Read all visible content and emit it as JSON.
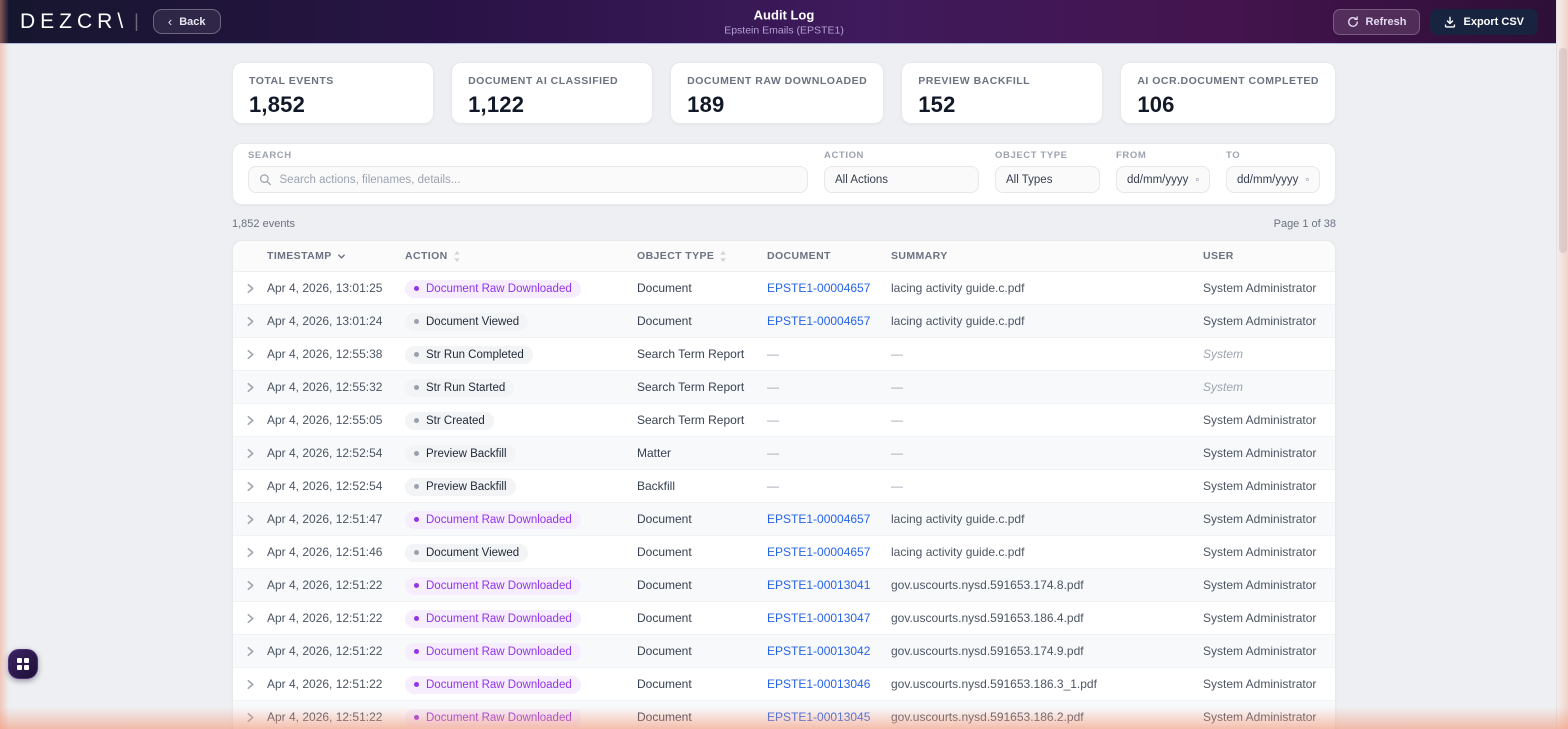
{
  "header": {
    "brand": "DEZCR\\",
    "back_label": "Back",
    "title": "Audit Log",
    "subtitle": "Epstein Emails (EPSTE1)",
    "refresh_label": "Refresh",
    "export_label": "Export CSV"
  },
  "stats": [
    {
      "label": "TOTAL EVENTS",
      "value": "1,852"
    },
    {
      "label": "DOCUMENT AI CLASSIFIED",
      "value": "1,122"
    },
    {
      "label": "DOCUMENT RAW DOWNLOADED",
      "value": "189"
    },
    {
      "label": "PREVIEW BACKFILL",
      "value": "152"
    },
    {
      "label": "AI OCR.DOCUMENT COMPLETED",
      "value": "106"
    }
  ],
  "filters": {
    "search_label": "SEARCH",
    "search_placeholder": "Search actions, filenames, details...",
    "action_label": "ACTION",
    "action_value": "All Actions",
    "object_type_label": "OBJECT TYPE",
    "object_type_value": "All Types",
    "from_label": "FROM",
    "from_value": "dd/mm/yyyy",
    "to_label": "TO",
    "to_value": "dd/mm/yyyy"
  },
  "meta": {
    "events_count": "1,852 events",
    "page_info": "Page 1 of 38"
  },
  "table": {
    "columns": [
      {
        "label": "TIMESTAMP",
        "sort": "down"
      },
      {
        "label": "ACTION",
        "sort": "both"
      },
      {
        "label": "OBJECT TYPE",
        "sort": "both"
      },
      {
        "label": "DOCUMENT",
        "sort": "none"
      },
      {
        "label": "SUMMARY",
        "sort": "none"
      },
      {
        "label": "USER",
        "sort": "none"
      }
    ],
    "rows": [
      {
        "ts": "Apr 4, 2026, 13:01:25",
        "action": "Document Raw Downloaded",
        "style": "purple",
        "type": "Document",
        "doc": "EPSTE1-00004657",
        "summary": "lacing activity guide.c.pdf",
        "user": "System Administrator",
        "user_style": "normal"
      },
      {
        "ts": "Apr 4, 2026, 13:01:24",
        "action": "Document Viewed",
        "style": "gray",
        "type": "Document",
        "doc": "EPSTE1-00004657",
        "summary": "lacing activity guide.c.pdf",
        "user": "System Administrator",
        "user_style": "normal"
      },
      {
        "ts": "Apr 4, 2026, 12:55:38",
        "action": "Str Run Completed",
        "style": "gray",
        "type": "Search Term Report",
        "doc": "—",
        "summary": "—",
        "user": "System",
        "user_style": "italic"
      },
      {
        "ts": "Apr 4, 2026, 12:55:32",
        "action": "Str Run Started",
        "style": "gray",
        "type": "Search Term Report",
        "doc": "—",
        "summary": "—",
        "user": "System",
        "user_style": "italic"
      },
      {
        "ts": "Apr 4, 2026, 12:55:05",
        "action": "Str Created",
        "style": "gray",
        "type": "Search Term Report",
        "doc": "—",
        "summary": "—",
        "user": "System Administrator",
        "user_style": "normal"
      },
      {
        "ts": "Apr 4, 2026, 12:52:54",
        "action": "Preview Backfill",
        "style": "gray",
        "type": "Matter",
        "doc": "—",
        "summary": "—",
        "user": "System Administrator",
        "user_style": "normal"
      },
      {
        "ts": "Apr 4, 2026, 12:52:54",
        "action": "Preview Backfill",
        "style": "gray",
        "type": "Backfill",
        "doc": "—",
        "summary": "—",
        "user": "System Administrator",
        "user_style": "normal"
      },
      {
        "ts": "Apr 4, 2026, 12:51:47",
        "action": "Document Raw Downloaded",
        "style": "purple",
        "type": "Document",
        "doc": "EPSTE1-00004657",
        "summary": "lacing activity guide.c.pdf",
        "user": "System Administrator",
        "user_style": "normal"
      },
      {
        "ts": "Apr 4, 2026, 12:51:46",
        "action": "Document Viewed",
        "style": "gray",
        "type": "Document",
        "doc": "EPSTE1-00004657",
        "summary": "lacing activity guide.c.pdf",
        "user": "System Administrator",
        "user_style": "normal"
      },
      {
        "ts": "Apr 4, 2026, 12:51:22",
        "action": "Document Raw Downloaded",
        "style": "purple",
        "type": "Document",
        "doc": "EPSTE1-00013041",
        "summary": "gov.uscourts.nysd.591653.174.8.pdf",
        "user": "System Administrator",
        "user_style": "normal"
      },
      {
        "ts": "Apr 4, 2026, 12:51:22",
        "action": "Document Raw Downloaded",
        "style": "purple",
        "type": "Document",
        "doc": "EPSTE1-00013047",
        "summary": "gov.uscourts.nysd.591653.186.4.pdf",
        "user": "System Administrator",
        "user_style": "normal"
      },
      {
        "ts": "Apr 4, 2026, 12:51:22",
        "action": "Document Raw Downloaded",
        "style": "purple",
        "type": "Document",
        "doc": "EPSTE1-00013042",
        "summary": "gov.uscourts.nysd.591653.174.9.pdf",
        "user": "System Administrator",
        "user_style": "normal"
      },
      {
        "ts": "Apr 4, 2026, 12:51:22",
        "action": "Document Raw Downloaded",
        "style": "purple",
        "type": "Document",
        "doc": "EPSTE1-00013046",
        "summary": "gov.uscourts.nysd.591653.186.3_1.pdf",
        "user": "System Administrator",
        "user_style": "normal"
      },
      {
        "ts": "Apr 4, 2026, 12:51:22",
        "action": "Document Raw Downloaded",
        "style": "purple",
        "type": "Document",
        "doc": "EPSTE1-00013045",
        "summary": "gov.uscourts.nysd.591653.186.2.pdf",
        "user": "System Administrator",
        "user_style": "normal"
      }
    ]
  },
  "colors": {
    "accent_purple": "#9333ea",
    "link_blue": "#2563eb",
    "export_button": "#18233f",
    "header_gradient_start": "#16162e",
    "header_gradient_mid": "#3f1a5c",
    "header_gradient_end": "#2d0f36",
    "page_background": "#edeff2",
    "edge_glow": "#f39e82"
  }
}
